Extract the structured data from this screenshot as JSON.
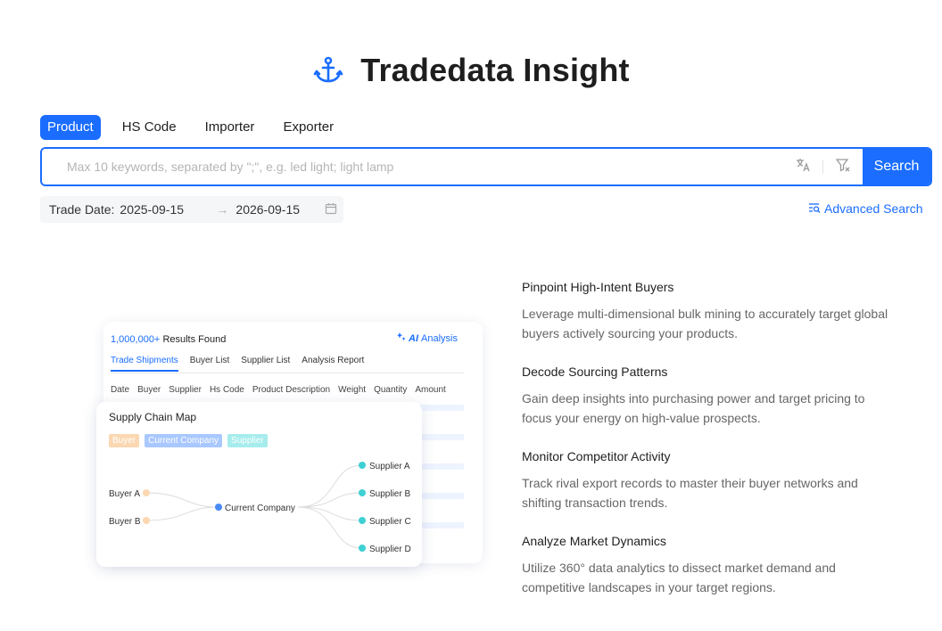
{
  "brand": {
    "title": "Tradedata Insight",
    "icon": "anchor-icon",
    "accent": "#1a6dff"
  },
  "tabs": [
    {
      "label": "Product",
      "active": true
    },
    {
      "label": "HS Code",
      "active": false
    },
    {
      "label": "Importer",
      "active": false
    },
    {
      "label": "Exporter",
      "active": false
    }
  ],
  "search": {
    "placeholder": "Max 10 keywords, separated by \";\", e.g. led light; light lamp",
    "value": "",
    "button_label": "Search"
  },
  "date": {
    "label": "Trade Date:",
    "start": "2025-09-15",
    "end": "2026-09-15"
  },
  "advanced_label": "Advanced Search",
  "illustration": {
    "results_count": "1,000,000+",
    "results_text": "Results Found",
    "ai_prefix": "AI",
    "ai_label": "Analysis",
    "tabs": [
      "Trade Shipments",
      "Buyer List",
      "Supplier List",
      "Analysis Report"
    ],
    "columns": [
      "Date",
      "Buyer",
      "Supplier",
      "Hs Code",
      "Product Description",
      "Weight",
      "Quantity",
      "Amount"
    ],
    "map_title": "Supply Chain Map",
    "chips": [
      "Buyer",
      "Current Company",
      "Supplier"
    ],
    "buyers": [
      "Buyer A",
      "Buyer B"
    ],
    "center": "Current Company",
    "suppliers": [
      "Supplier A",
      "Supplier B",
      "Supplier C",
      "Supplier D"
    ]
  },
  "features": [
    {
      "title": "Pinpoint High-Intent Buyers",
      "text": "Leverage multi-dimensional bulk mining to accurately target global buyers actively sourcing your products."
    },
    {
      "title": "Decode Sourcing Patterns",
      "text": "Gain deep insights into purchasing power and target pricing to focus your energy on high-value prospects."
    },
    {
      "title": "Monitor Competitor Activity",
      "text": "Track rival export records to master their buyer networks and shifting transaction trends."
    },
    {
      "title": "Analyze Market Dynamics",
      "text": "Utilize 360° data analytics to dissect market demand and competitive landscapes in your target regions."
    }
  ]
}
